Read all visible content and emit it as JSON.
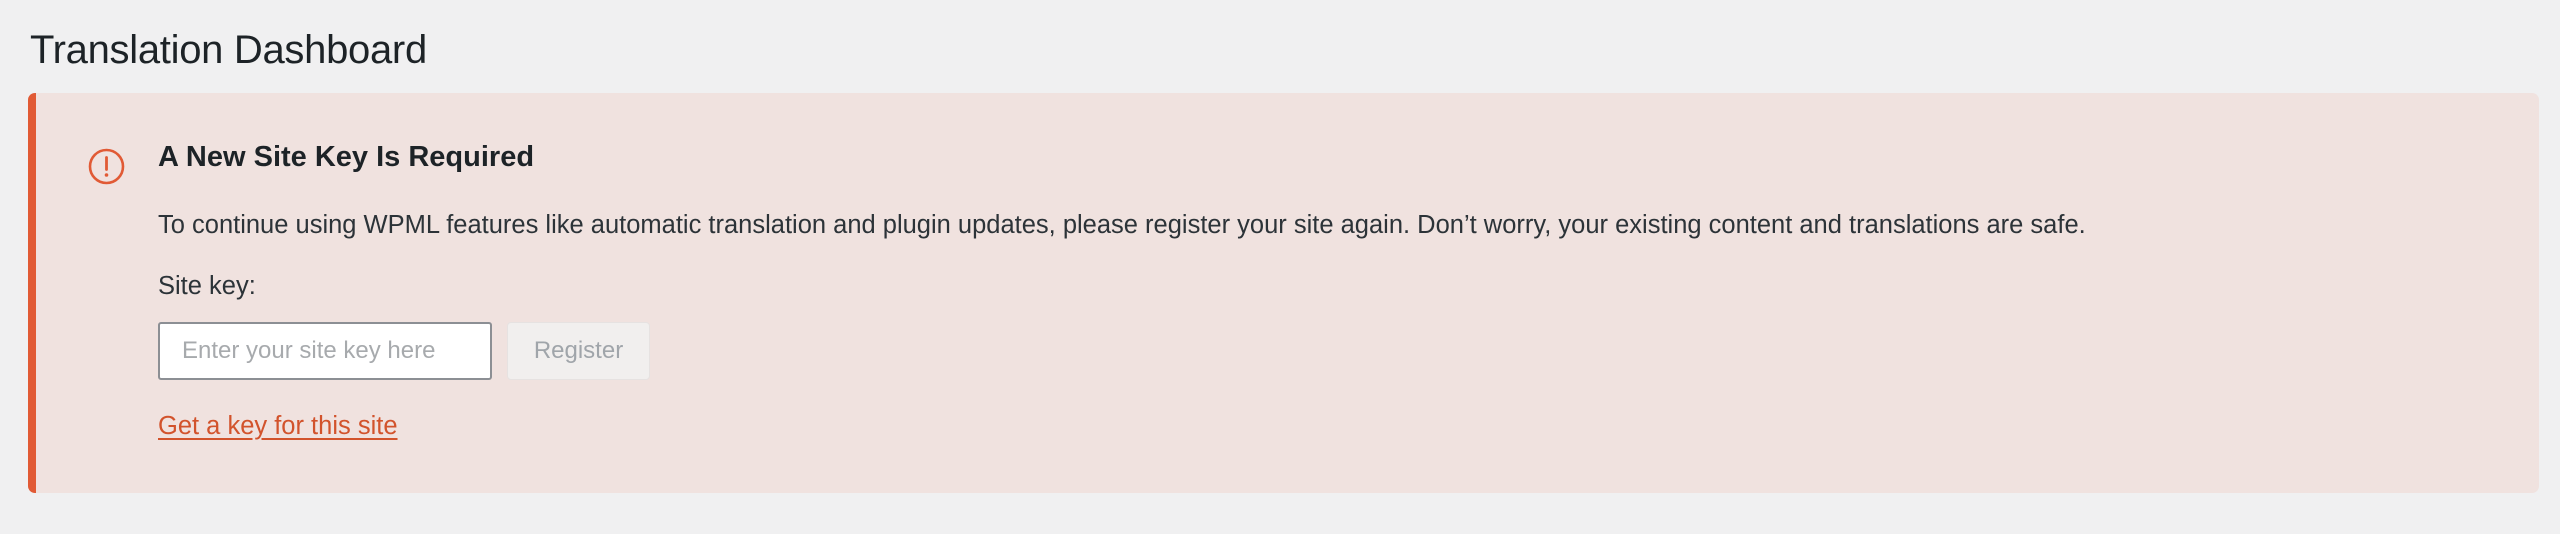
{
  "page": {
    "title": "Translation Dashboard"
  },
  "notice": {
    "icon": "exclamation-circle-icon",
    "accent_color": "#e15a35",
    "background_color": "#f0e2df",
    "title": "A New Site Key Is Required",
    "message": "To continue using WPML features like automatic translation and plugin updates, please register your site again. Don’t worry, your existing content and translations are safe.",
    "site_key_label": "Site key:",
    "site_key_value": "",
    "site_key_placeholder": "Enter your site key here",
    "register_label": "Register",
    "get_key_link": "Get a key for this site"
  }
}
